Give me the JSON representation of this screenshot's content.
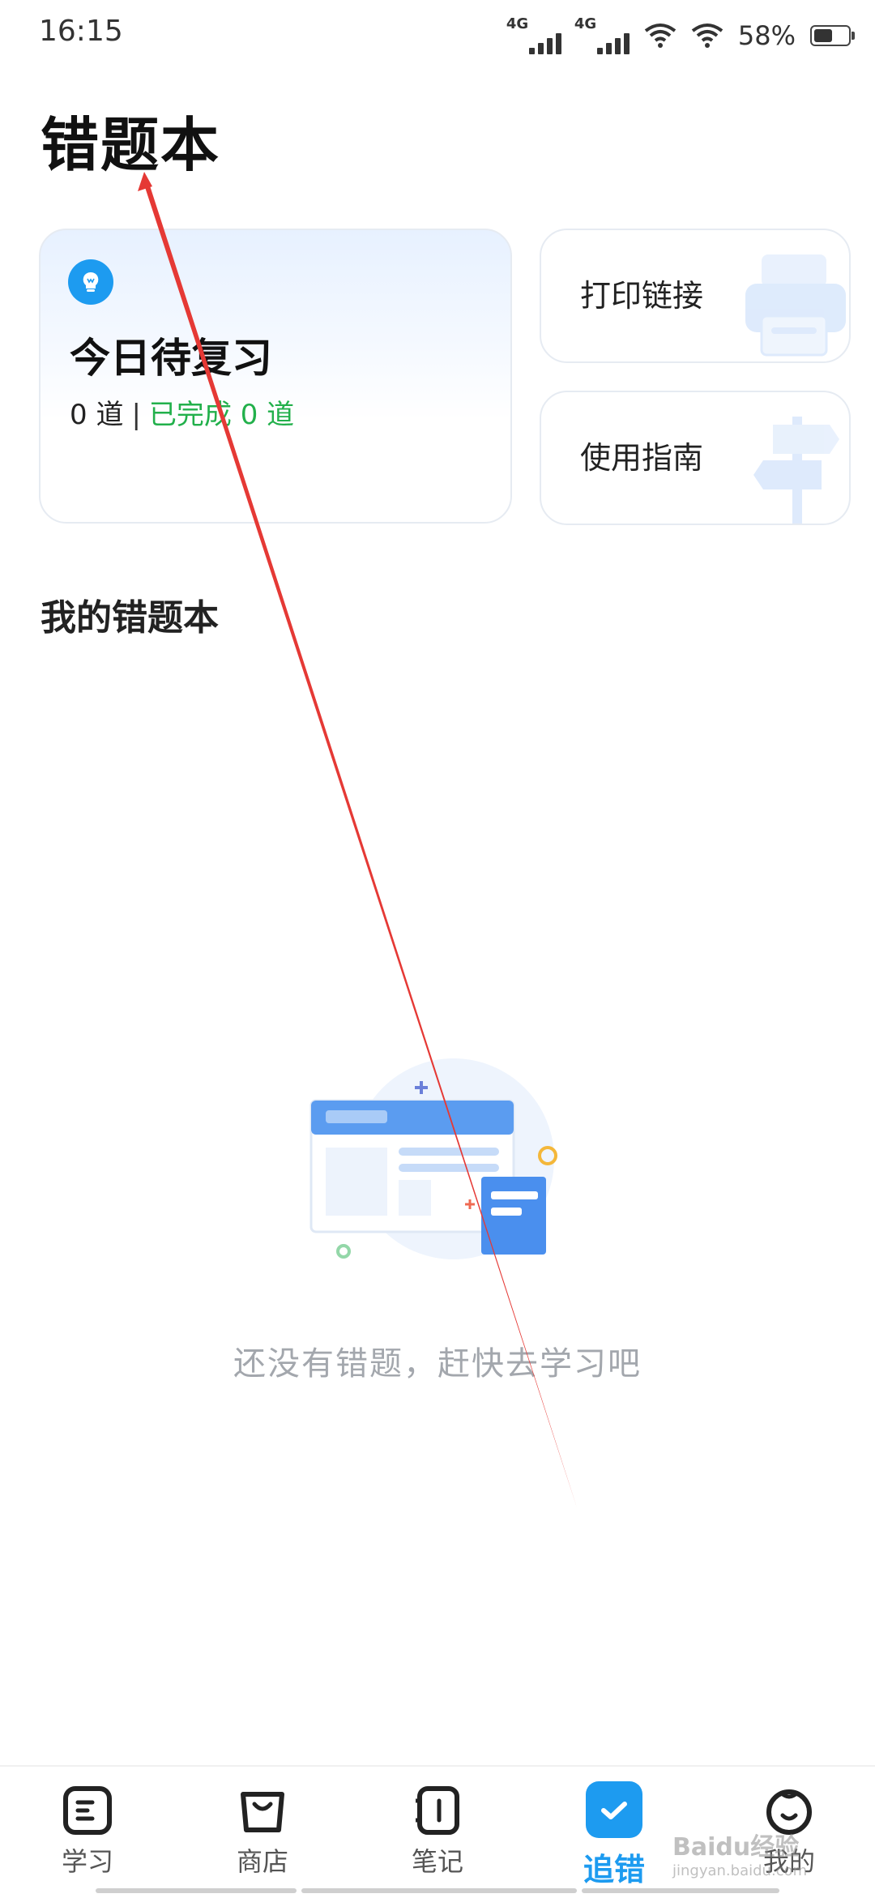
{
  "status_bar": {
    "time": "16:15",
    "network_label_1": "4G",
    "network_label_2": "4G",
    "battery_text": "58%",
    "battery_level": 0.58
  },
  "page": {
    "title": "错题本"
  },
  "review_card": {
    "title": "今日待复习",
    "count_text": "0 道",
    "separator": "|",
    "done_text": "已完成 0 道",
    "icon": "lightbulb-icon"
  },
  "side_cards": [
    {
      "label": "打印链接",
      "icon": "printer-icon"
    },
    {
      "label": "使用指南",
      "icon": "signpost-icon"
    }
  ],
  "section": {
    "title": "我的错题本"
  },
  "empty_state": {
    "text": "还没有错题，赶快去学习吧",
    "illustration": "empty-notebook-illustration"
  },
  "bottom_nav": {
    "items": [
      {
        "label": "学习",
        "icon": "study-icon",
        "active": false
      },
      {
        "label": "商店",
        "icon": "shop-bag-icon",
        "active": false
      },
      {
        "label": "笔记",
        "icon": "notebook-icon",
        "active": false
      },
      {
        "label": "追错",
        "icon": "check-icon",
        "active": true
      },
      {
        "label": "我的",
        "icon": "profile-face-icon",
        "active": false
      }
    ]
  },
  "watermark": {
    "text": "Baidu经验",
    "subtext": "jingyan.baidu.com"
  },
  "colors": {
    "accent": "#1d9bf0",
    "done_green": "#22b04b",
    "annotation_red": "#e53935"
  }
}
